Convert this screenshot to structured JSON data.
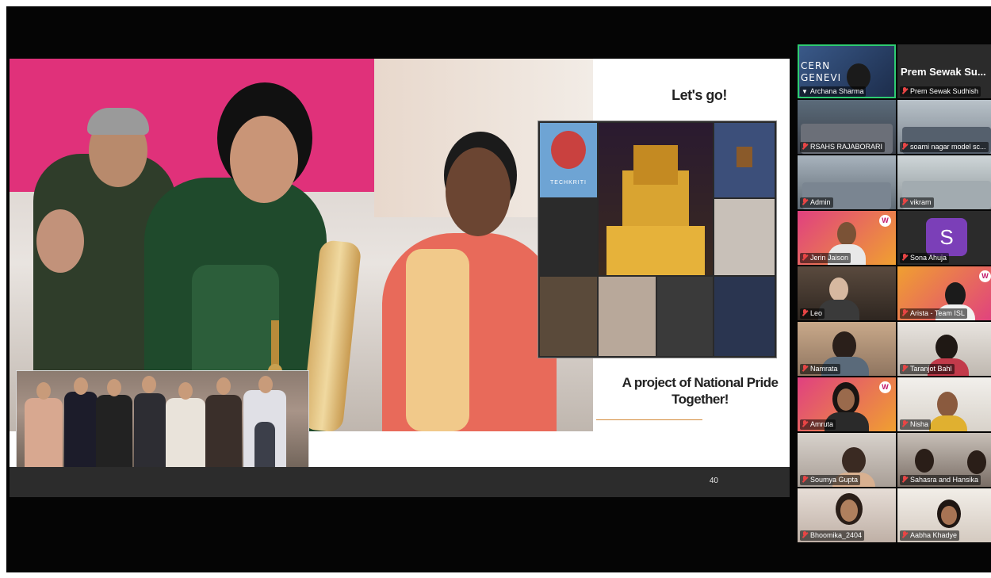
{
  "slide": {
    "heading": "Let's go!",
    "tagline_line1": "A project of National Pride",
    "tagline_line2": "Together!",
    "page_number": "40",
    "collage_caption": "TECHKRITI"
  },
  "participants": {
    "top_left_pinned": {
      "name": "Archana Sharma",
      "bg_text_line1": "CERN",
      "bg_text_line2": "GENEVI"
    },
    "top_right": {
      "display_name": "Prem  Sewak  Su...",
      "name": "Prem Sewak Sudhish"
    },
    "tiles": [
      "RSAHS RAJABORARI",
      "soami nagar model sc...",
      "Admin",
      "vikram",
      "Jerin Jaison",
      "Sona Ahuja",
      "Leo",
      "Arista - Team ISL",
      "Namrata",
      "Taranjot Bahl",
      "Amruta",
      "Nisha",
      "Soumya Gupta",
      "Sahasra and Hansika",
      "Bhoomika_2404",
      "Aabha Khadye"
    ],
    "avatar_letter": "S"
  },
  "colors": {
    "active_speaker_border": "#2ecc71",
    "muted_icon": "#e84545",
    "avatar_purple": "#7b3fb8",
    "accent_line": "#d48a3a"
  },
  "icons": {
    "muted": "mic-off-icon",
    "pinned": "pin-icon",
    "badge": "w-badge-icon"
  }
}
